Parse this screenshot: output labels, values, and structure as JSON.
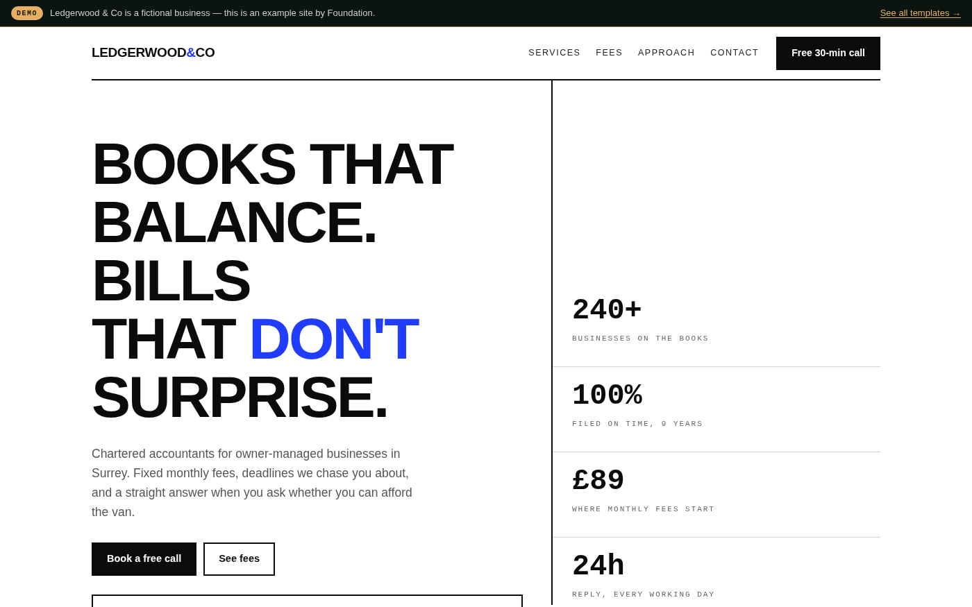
{
  "banner": {
    "badge": "DEMO",
    "text": "Ledgerwood & Co is a fictional business — this is an example site by Foundation.",
    "link": "See all templates →"
  },
  "logo": [
    {
      "text": "LEDGERWOOD",
      "accent": false
    },
    {
      "text": "&",
      "accent": true
    },
    {
      "text": "CO",
      "accent": false
    }
  ],
  "nav": {
    "items": [
      "SERVICES",
      "FEES",
      "APPROACH",
      "CONTACT"
    ],
    "cta": "Free 30-min call"
  },
  "headline": [
    [
      {
        "text": "BOOKS THAT",
        "accent": false
      }
    ],
    [
      {
        "text": "BALANCE.",
        "accent": false
      }
    ],
    [
      {
        "text": "BILLS",
        "accent": false
      }
    ],
    [
      {
        "text": "THAT ",
        "accent": false
      },
      {
        "text": "DON'T",
        "accent": true
      }
    ],
    [
      {
        "text": "SURPRISE.",
        "accent": false
      }
    ]
  ],
  "intro": "Chartered accountants for owner-managed businesses in Surrey. Fixed monthly fees, deadlines we chase you about, and a straight answer when you ask whether you can afford the van.",
  "buttons": [
    {
      "label": "Book a free call",
      "kind": "primary"
    },
    {
      "label": "See fees",
      "kind": "outline"
    }
  ],
  "stats": [
    {
      "value": "240+",
      "label": "BUSINESSES ON THE BOOKS"
    },
    {
      "value": "100%",
      "label": "FILED ON TIME, 9 YEARS"
    },
    {
      "value": "£89",
      "label": "WHERE MONTHLY FEES START"
    },
    {
      "value": "24h",
      "label": "REPLY, EVERY WORKING DAY"
    }
  ]
}
